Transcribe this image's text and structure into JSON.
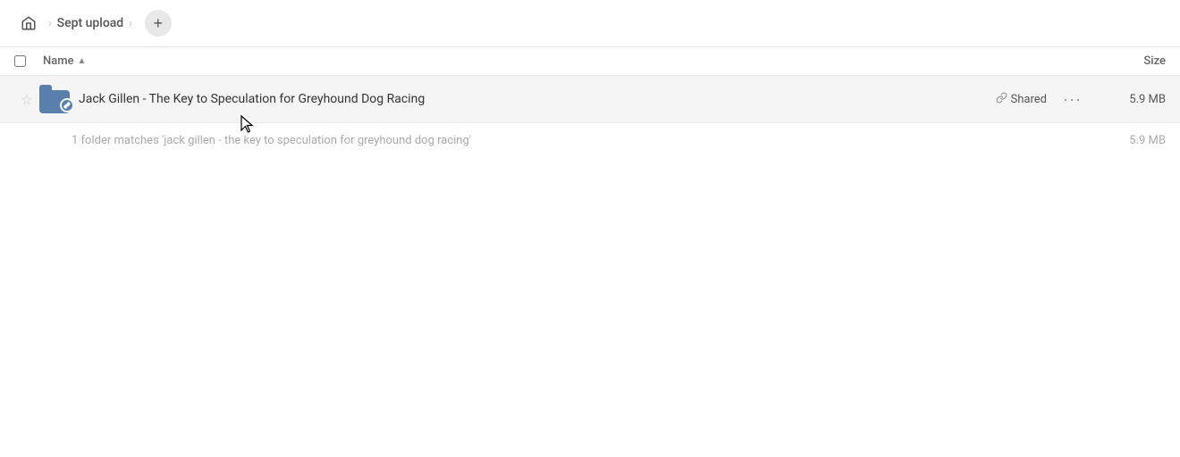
{
  "toolbar": {
    "home_label": "Home",
    "breadcrumb_folder": "Sept upload",
    "add_button_label": "+"
  },
  "column_headers": {
    "name_label": "Name",
    "sort_arrow": "▲",
    "size_label": "Size"
  },
  "file_row": {
    "name": "Jack Gillen - The Key to Speculation for Greyhound Dog Racing",
    "shared_label": "Shared",
    "size": "5.9 MB",
    "more_icon": "···"
  },
  "match_info": {
    "text": "1 folder matches 'jack gillen - the key to speculation for greyhound dog racing'",
    "size": "5.9 MB"
  },
  "icons": {
    "home": "⌂",
    "star": "★",
    "link": "🔗",
    "chevron_right": "›"
  }
}
